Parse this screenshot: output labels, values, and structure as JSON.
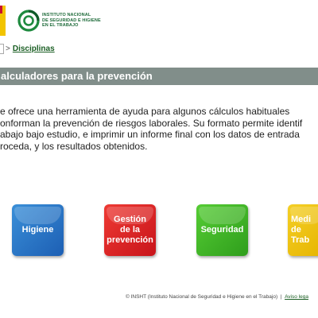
{
  "header": {
    "logo_lines": [
      "INSTITUTO NACIONAL",
      "DE SEGURIDAD E HIGIENE",
      "EN EL TRABAJO"
    ],
    "logo_icon": "insht-logo-icon"
  },
  "breadcrumb": {
    "separator": ">",
    "current": "Disciplinas"
  },
  "title": "alculadores para la prevención",
  "intro_lines": [
    "e ofrece una herramienta de ayuda para algunos cálculos habituales",
    "onforman la prevención de riesgos laborales. Su formato permite identif",
    "abajo bajo estudio, e imprimir un informe final con los datos de entrada",
    "roceda, y los resultados obtenidos."
  ],
  "tiles": [
    {
      "label": "Higiene",
      "color": "#1d5fb4"
    },
    {
      "label": "Gestión\nde la\nprevención",
      "color": "#c8141a"
    },
    {
      "label": "Seguridad",
      "color": "#2f9e1c"
    },
    {
      "label": "Medi\nde\nTrab",
      "color": "#e6b400"
    }
  ],
  "footer": {
    "copyright": "© INSHT (Instituto Nacional de Seguridad e Higiene en el Trabajo)",
    "separator": "|",
    "link": "Aviso lega"
  }
}
